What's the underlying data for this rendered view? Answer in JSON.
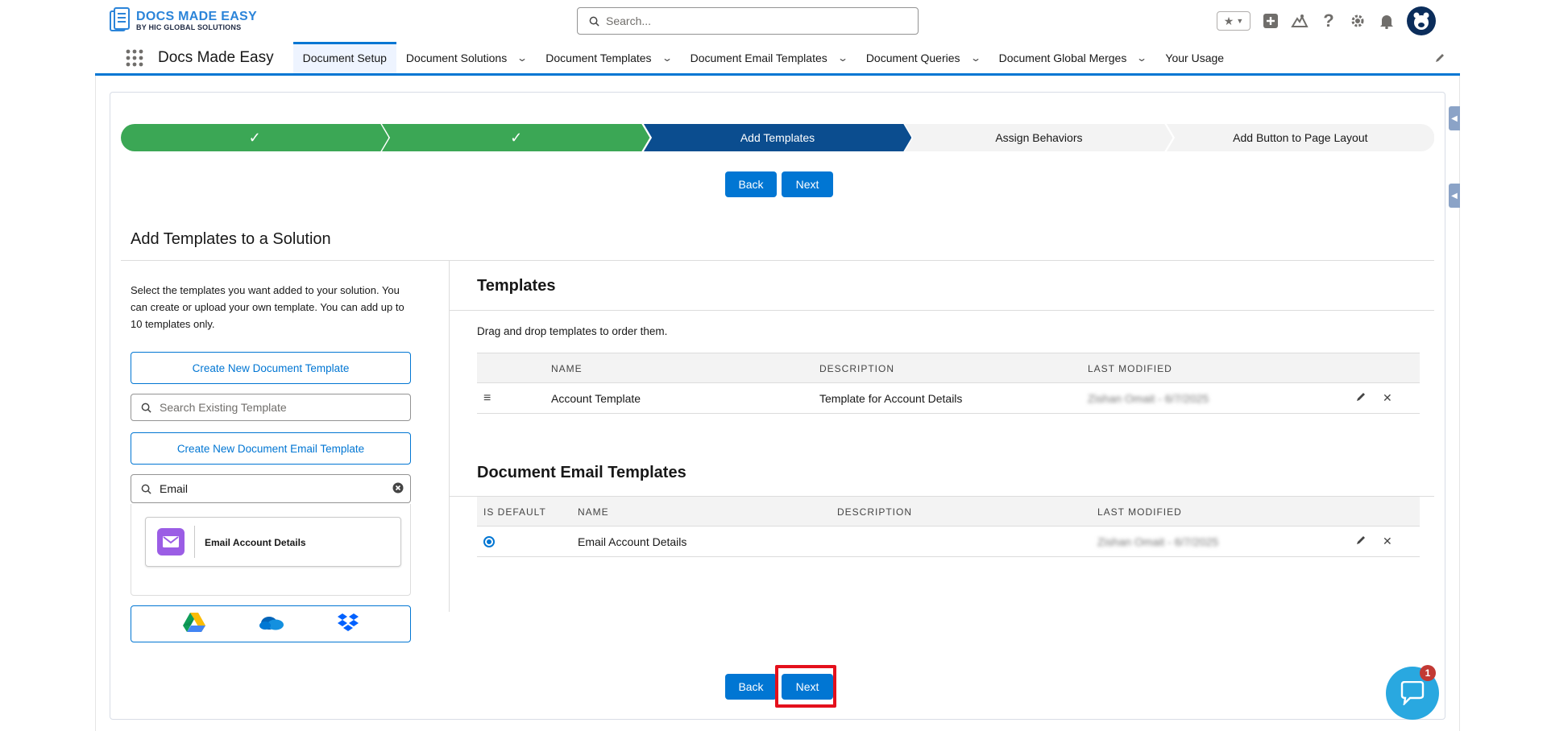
{
  "brand": {
    "line1": "DOCS MADE EASY",
    "line2": "BY HIC GLOBAL SOLUTIONS",
    "primary_color": "#0176d3",
    "success_color": "#3ba755",
    "dark_step_color": "#0b4d8f"
  },
  "search": {
    "placeholder": "Search..."
  },
  "header_icons": [
    "favorites-star-icon",
    "add-icon",
    "trailhead-icon",
    "help-icon",
    "settings-gear-icon",
    "notifications-bell-icon",
    "user-avatar"
  ],
  "nav": {
    "app_name": "Docs Made Easy",
    "items": [
      {
        "label": "Document Setup",
        "active": true,
        "dropdown": false
      },
      {
        "label": "Document Solutions",
        "active": false,
        "dropdown": true
      },
      {
        "label": "Document Templates",
        "active": false,
        "dropdown": true
      },
      {
        "label": "Document Email Templates",
        "active": false,
        "dropdown": true
      },
      {
        "label": "Document Queries",
        "active": false,
        "dropdown": true
      },
      {
        "label": "Document Global Merges",
        "active": false,
        "dropdown": true
      },
      {
        "label": "Your Usage",
        "active": false,
        "dropdown": false
      }
    ]
  },
  "path": {
    "steps": [
      {
        "label": "",
        "state": "complete"
      },
      {
        "label": "",
        "state": "complete"
      },
      {
        "label": "Add Templates",
        "state": "current"
      },
      {
        "label": "Assign Behaviors",
        "state": "incomplete"
      },
      {
        "label": "Add Button to Page Layout",
        "state": "incomplete"
      }
    ]
  },
  "buttons": {
    "back": "Back",
    "next": "Next"
  },
  "page": {
    "title": "Add Templates to a Solution",
    "help": "Select the templates you want added to your solution. You can create or upload your own template. You can add up to 10 templates only.",
    "create_doc_template": "Create New Document Template",
    "search_existing_placeholder": "Search Existing Template",
    "create_email_template": "Create New Document Email Template",
    "email_search_value": "Email",
    "email_result": "Email Account Details",
    "cloud_icons": [
      "google-drive-icon",
      "onedrive-icon",
      "dropbox-icon"
    ]
  },
  "templates": {
    "title": "Templates",
    "help": "Drag and drop templates to order them.",
    "columns": [
      "Name",
      "Description",
      "Last Modified"
    ],
    "rows": [
      {
        "name": "Account Template",
        "description": "Template for Account Details",
        "last_modified": "Zishan Omait - 6/7/2025"
      }
    ]
  },
  "email_templates": {
    "title": "Document Email Templates",
    "columns": [
      "Is Default",
      "Name",
      "Description",
      "Last Modified"
    ],
    "rows": [
      {
        "is_default": true,
        "name": "Email Account Details",
        "description": "",
        "last_modified": "Zishan Omait - 6/7/2025"
      }
    ]
  },
  "chat": {
    "badge": "1"
  }
}
